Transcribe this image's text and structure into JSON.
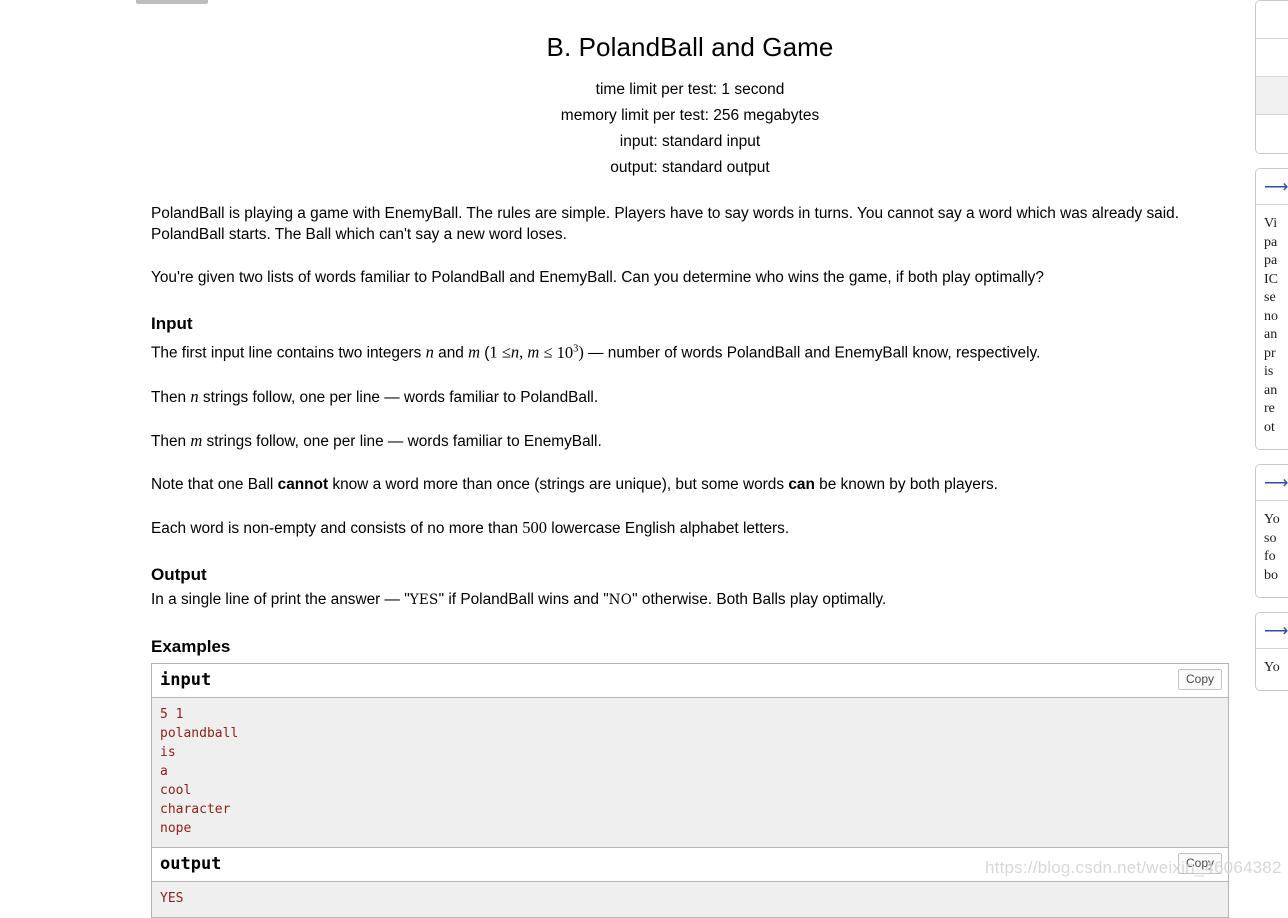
{
  "problem": {
    "title": "B. PolandBall and Game",
    "limits": [
      "time limit per test: 1 second",
      "memory limit per test: 256 megabytes",
      "input: standard input",
      "output: standard output"
    ],
    "intro_p1": "PolandBall is playing a game with EnemyBall. The rules are simple. Players have to say words in turns. You cannot say a word which was already said. PolandBall starts. The Ball which can't say a new word loses.",
    "intro_p2": "You're given two lists of words familiar to PolandBall and EnemyBall. Can you determine who wins the game, if both play optimally?"
  },
  "input_section": {
    "heading": "Input",
    "line1_a": "The first input line contains two integers ",
    "line1_var_n": "n",
    "line1_b": " and ",
    "line1_var_m": "m",
    "line1_paren_open": " (",
    "line1_math_1": "1 ",
    "line1_math_le1": "≤",
    "line1_math_n": "n",
    "line1_math_comma": ", ",
    "line1_math_m": "m",
    "line1_math_le2": " ≤ ",
    "line1_math_10": "10",
    "line1_math_exp": "3",
    "line1_paren_close": ")",
    "line1_c": " — number of words PolandBall and EnemyBall know, respectively.",
    "line2_a": "Then ",
    "line2_var": "n",
    "line2_b": " strings follow, one per line — words familiar to PolandBall.",
    "line3_a": "Then ",
    "line3_var": "m",
    "line3_b": " strings follow, one per line — words familiar to EnemyBall.",
    "note_a": "Note that one Ball ",
    "note_bold1": "cannot",
    "note_b": " know a word more than once (strings are unique), but some words ",
    "note_bold2": "can",
    "note_c": " be known by both players.",
    "each_a": "Each word is non-empty and consists of no more than ",
    "each_num": "500",
    "each_b": " lowercase English alphabet letters."
  },
  "output_section": {
    "heading": "Output",
    "text_a": "In a single line of print the answer — \"",
    "text_yes": "YES",
    "text_b": "\" if PolandBall wins and \"",
    "text_no": "NO",
    "text_c": "\" otherwise. Both Balls play optimally."
  },
  "examples": {
    "heading": "Examples",
    "copy_label": "Copy",
    "blocks": [
      {
        "label": "input",
        "content": "5 1\npolandball\nis\na\ncool\ncharacter\nnope"
      },
      {
        "label": "output",
        "content": "YES"
      }
    ]
  },
  "sidebar": {
    "arrow_glyph": "⟶",
    "boxes": [
      {
        "type": "rows",
        "rows": [
          "",
          "",
          "",
          ""
        ]
      },
      {
        "type": "panel",
        "text": "Vi\npa\npa\nIC\nse\nno\nan\npr\nis\nan\nre\not"
      },
      {
        "type": "panel",
        "text": "Yo\nso\nfo\nbo"
      },
      {
        "type": "panel",
        "text": "Yo"
      }
    ]
  },
  "watermark": {
    "text": "https://blog.csdn.net/weixin_46064382"
  },
  "colors": {
    "sample_text": "#8c2318",
    "sample_bg": "#efefef",
    "border": "#b5b5b5",
    "arrow": "#2b4fa0",
    "watermark": "#d8d8d8"
  }
}
